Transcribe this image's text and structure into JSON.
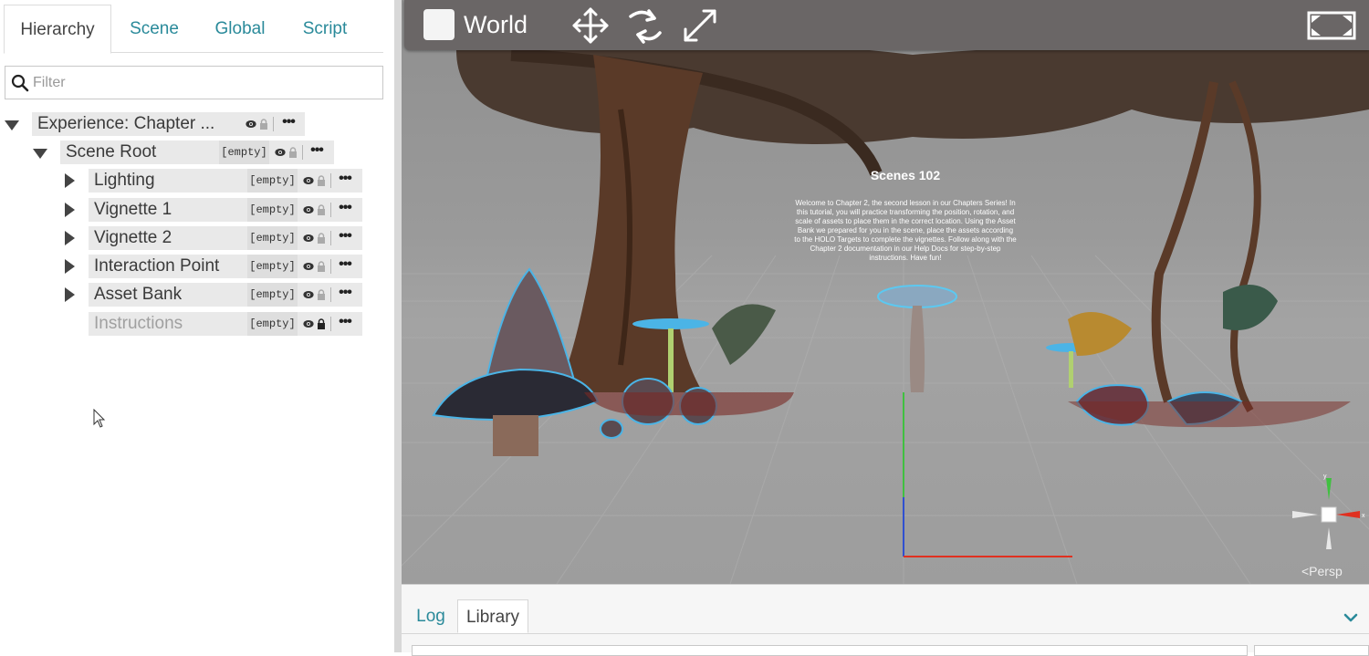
{
  "hierarchy_tabs": [
    {
      "label": "Hierarchy",
      "active": true
    },
    {
      "label": "Scene",
      "active": false
    },
    {
      "label": "Global",
      "active": false
    },
    {
      "label": "Script",
      "active": false
    }
  ],
  "filter": {
    "placeholder": "Filter",
    "value": ""
  },
  "tree": [
    {
      "label": "Experience: Chapter ...",
      "expanded": true,
      "badge": ""
    },
    {
      "label": "Scene Root",
      "expanded": true,
      "badge": "[empty]"
    },
    {
      "label": "Lighting",
      "expanded": false,
      "badge": "[empty]"
    },
    {
      "label": "Vignette 1",
      "expanded": false,
      "badge": "[empty]"
    },
    {
      "label": "Vignette 2",
      "expanded": false,
      "badge": "[empty]"
    },
    {
      "label": "Interaction Point",
      "expanded": false,
      "badge": "[empty]"
    },
    {
      "label": "Asset Bank",
      "expanded": false,
      "badge": "[empty]"
    },
    {
      "label": "Instructions",
      "expanded": false,
      "badge": "[empty]",
      "locked": true
    }
  ],
  "viewport": {
    "space_label": "World",
    "tools": [
      "move-icon",
      "rotate-icon",
      "scale-icon",
      "fullscreen-icon"
    ],
    "scene_title": "Scenes 102",
    "scene_text": "Welcome to Chapter 2, the second lesson in our Chapters Series! In this tutorial, you will practice transforming the position, rotation, and scale of assets to place them in the correct location. Using the Asset Bank we prepared for you in the scene, place the assets according to the HOLO Targets to complete the vignettes. Follow along with the Chapter 2 documentation in our Help Docs for step-by-step instructions. Have fun!",
    "projection_label": "<Persp",
    "gizmo_axes": [
      "y",
      "x"
    ]
  },
  "bottom_tabs": [
    {
      "label": "Log",
      "active": false
    },
    {
      "label": "Library",
      "active": true
    }
  ],
  "colors": {
    "accent": "#2a8a9a",
    "toolbar": "#6a6666",
    "axis_x": "#e03020",
    "axis_y": "#40c040"
  }
}
